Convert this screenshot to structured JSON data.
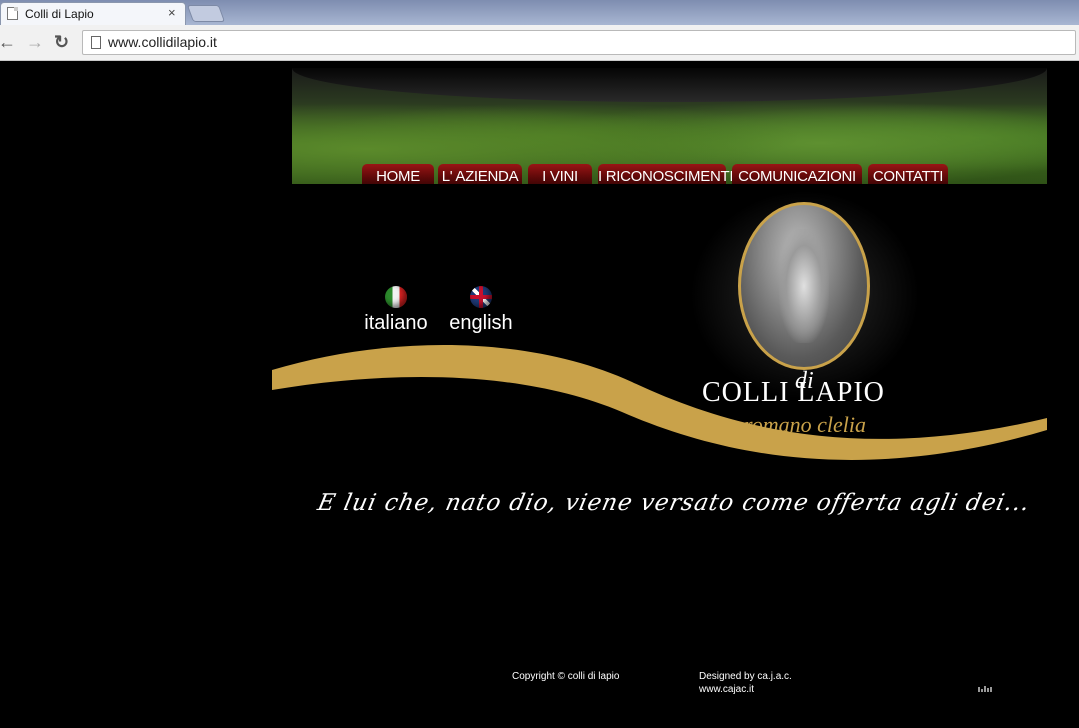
{
  "browser": {
    "tab_title": "Colli di Lapio",
    "tab_close": "×",
    "back_glyph": "←",
    "forward_glyph": "→",
    "reload_glyph": "↻",
    "url": "www.collidilapio.it"
  },
  "nav": {
    "items": [
      {
        "label": "HOME"
      },
      {
        "label": "L' AZIENDA"
      },
      {
        "label": "I VINI"
      },
      {
        "label": "I RICONOSCIMENTI"
      },
      {
        "label": "COMUNICAZIONI"
      },
      {
        "label": "CONTATTI"
      }
    ]
  },
  "languages": [
    {
      "label": "italiano",
      "flag": "italy-flag-icon"
    },
    {
      "label": "english",
      "flag": "uk-flag-icon"
    }
  ],
  "logo": {
    "main": "COLLI    LAPIO",
    "di": "di",
    "subtitle": "romano clelia"
  },
  "tagline": "E lui che, nato dio, viene versato come offerta agli dei...",
  "footer": {
    "copyright": "Copyright © colli di lapio",
    "designed_by": "Designed by ca.j.a.c.",
    "designer_url": "www.cajac.it"
  },
  "colors": {
    "accent_gold": "#c9a24a",
    "nav_red": "#7a0c0c",
    "background": "#000000"
  }
}
